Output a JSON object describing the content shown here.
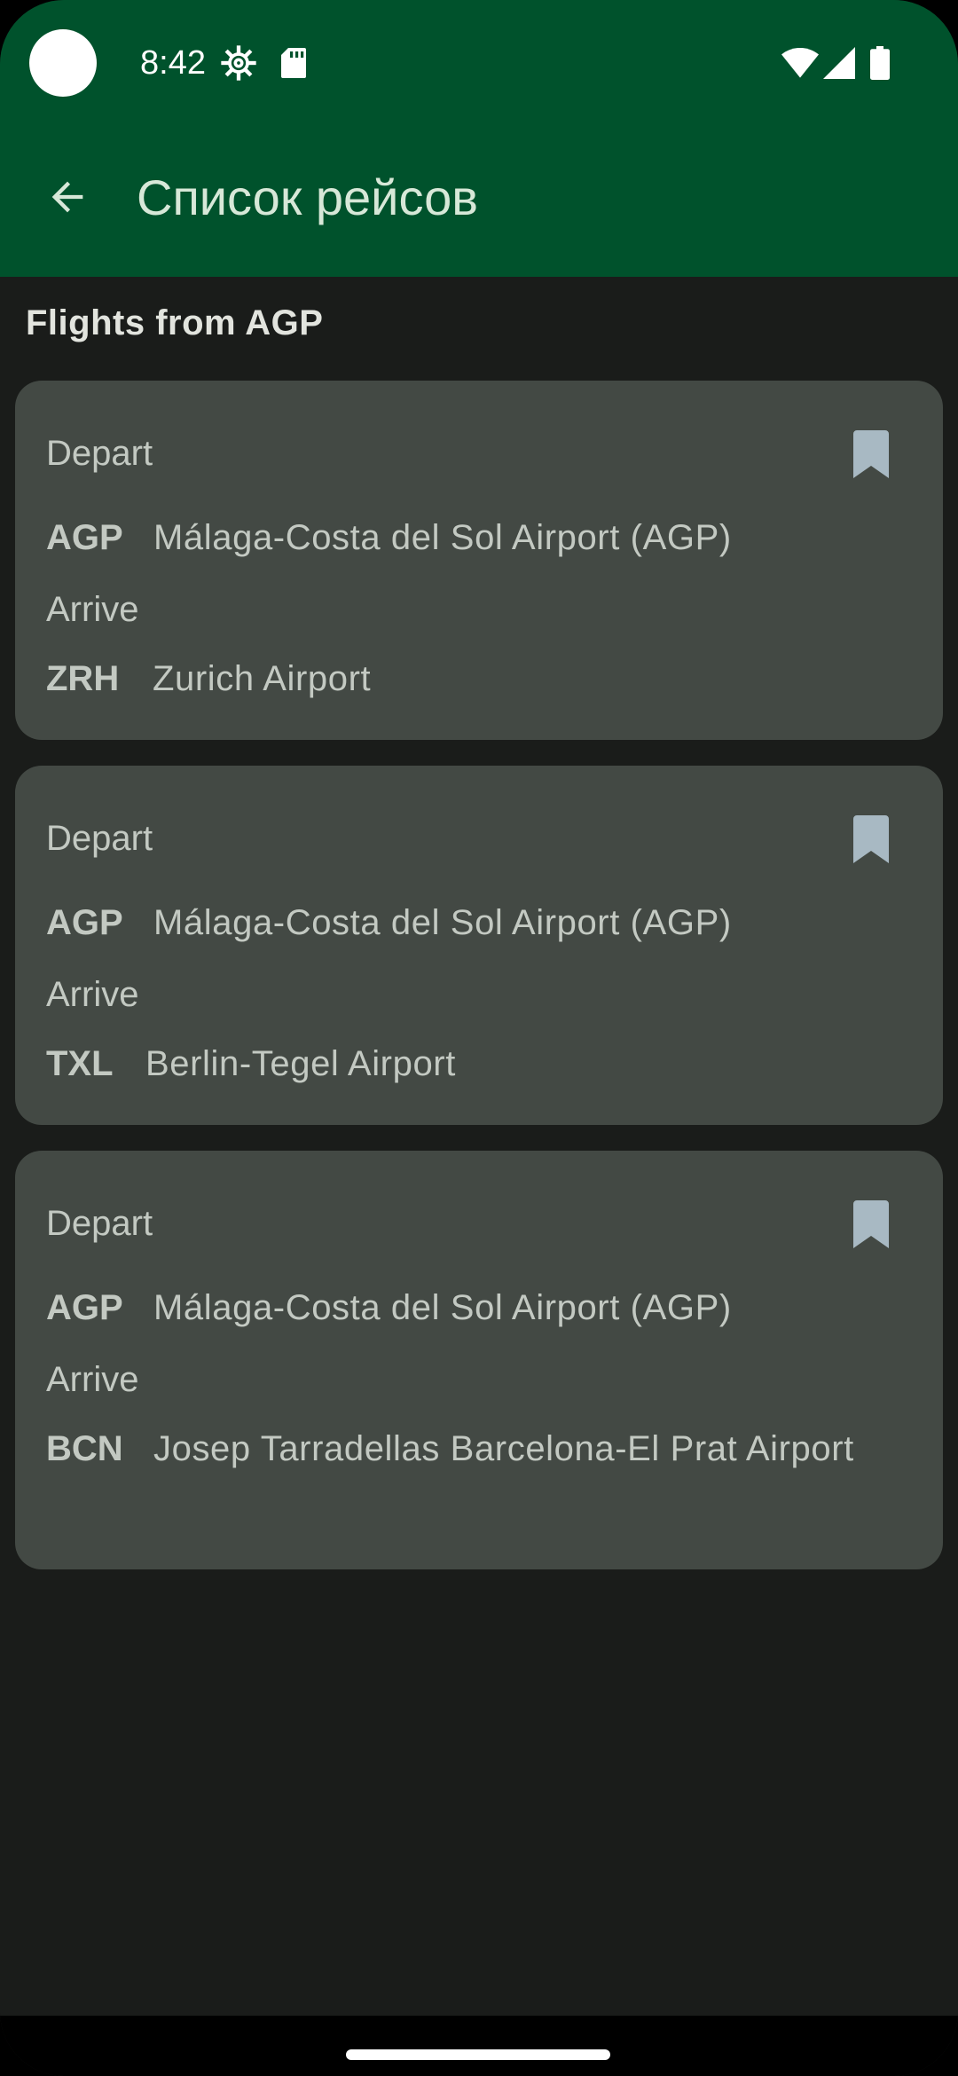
{
  "status_bar": {
    "time": "8:42",
    "icons": [
      "settings-gear-icon",
      "sd-card-icon",
      "wifi-icon",
      "cell-signal-icon",
      "battery-icon"
    ]
  },
  "app_bar": {
    "back_icon": "arrow-back-icon",
    "title": "Список рейсов"
  },
  "main": {
    "heading": "Flights from AGP",
    "flights": [
      {
        "depart_label": "Depart",
        "depart_code": "AGP",
        "depart_name": "Málaga-Costa del Sol Airport (AGP)",
        "arrive_label": "Arrive",
        "arrive_code": "ZRH",
        "arrive_name": "Zurich Airport",
        "bookmark_icon": "bookmark-icon"
      },
      {
        "depart_label": "Depart",
        "depart_code": "AGP",
        "depart_name": "Málaga-Costa del Sol Airport (AGP)",
        "arrive_label": "Arrive",
        "arrive_code": "TXL",
        "arrive_name": "Berlin-Tegel Airport",
        "bookmark_icon": "bookmark-icon"
      },
      {
        "depart_label": "Depart",
        "depart_code": "AGP",
        "depart_name": "Málaga-Costa del Sol Airport (AGP)",
        "arrive_label": "Arrive",
        "arrive_code": "BCN",
        "arrive_name": "Josep Tarradellas Barcelona-El Prat Airport",
        "bookmark_icon": "bookmark-icon"
      }
    ]
  },
  "colors": {
    "header_green": "#00522c",
    "background": "#1a1c1a",
    "card": "#434944",
    "text": "#c3c9c2",
    "bookmark": "#a8b9c3"
  }
}
